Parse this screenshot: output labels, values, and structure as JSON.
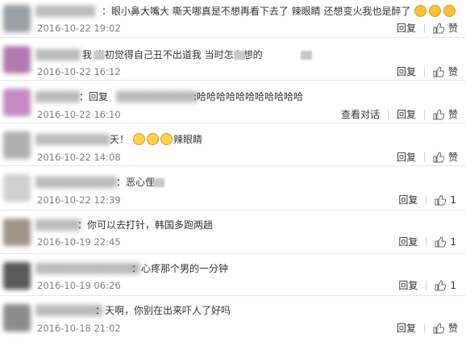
{
  "comments": [
    {
      "name": "：",
      "text": "眼小鼻大嘴大  嘶天哪真是不想再看下去了 辣眼睛 还想变火我也是醉了",
      "time": "2016-10-22 19:02",
      "reply": "回复",
      "like": "赞",
      "likes": "",
      "view": ""
    },
    {
      "name": "",
      "text": "我  当初觉得自己丑不出道我   当时怎么想的",
      "time": "2016-10-22 16:12",
      "reply": "回复",
      "like": "赞",
      "likes": "",
      "view": ""
    },
    {
      "name": "：回复",
      "text": ":哈哈哈哈哈哈哈哈哈哈哈",
      "time": "2016-10-22 16:10",
      "reply": "回复",
      "like": "赞",
      "likes": "",
      "view": "查看对话"
    },
    {
      "name": "",
      "text": "天！",
      "text2": "辣眼睛",
      "time": "2016-10-22 14:08",
      "reply": "回复",
      "like": "赞",
      "likes": "",
      "view": ""
    },
    {
      "name": "：",
      "text": "恶心俚",
      "time": "2016-10-22 12:39",
      "reply": "回复",
      "like": "",
      "likes": "1",
      "view": ""
    },
    {
      "name": "：",
      "text": "你可以去打针，韩国多跑两趟",
      "time": "2016-10-19 22:45",
      "reply": "回复",
      "like": "",
      "likes": "1",
      "view": ""
    },
    {
      "name": "：",
      "text": "心疼那个男的一分钟",
      "time": "2016-10-19 06:26",
      "reply": "回复",
      "like": "",
      "likes": "1",
      "view": ""
    },
    {
      "name": "：",
      "text": "天啊，你别在出来吓人了好吗",
      "time": "2016-10-18 21:02",
      "reply": "回复",
      "like": "赞",
      "likes": "",
      "view": ""
    }
  ],
  "icons": {
    "like": "thumbs-up-icon",
    "emoji_smile": "smile-emoji-icon",
    "emoji_laugh": "laugh-emoji-icon"
  },
  "colors": {
    "text": "#333333",
    "time": "#808080",
    "divider": "#e6e6e6"
  }
}
